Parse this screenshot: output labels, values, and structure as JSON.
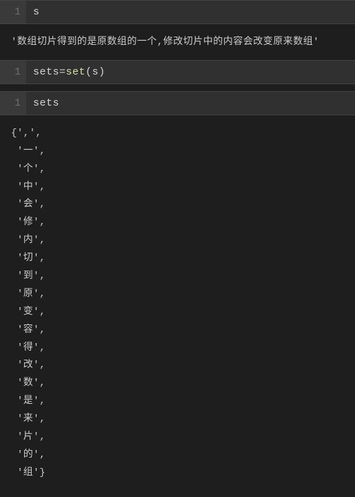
{
  "cells": [
    {
      "lineNum": "1",
      "codeParts": {
        "var1": "s"
      }
    },
    {
      "output": "'数组切片得到的是原数组的一个,修改切片中的内容会改变原来数组'"
    },
    {
      "lineNum": "1",
      "codeParts": {
        "lhs": "sets",
        "eq": "=",
        "fn": "set",
        "lp": "(",
        "arg": "s",
        "rp": ")"
      }
    },
    {
      "lineNum": "1",
      "codeParts": {
        "var1": "sets"
      }
    },
    {
      "output": "{',',\n '一',\n '个',\n '中',\n '会',\n '修',\n '内',\n '切',\n '到',\n '原',\n '变',\n '容',\n '得',\n '改',\n '数',\n '是',\n '来',\n '片',\n '的',\n '组'}"
    }
  ]
}
